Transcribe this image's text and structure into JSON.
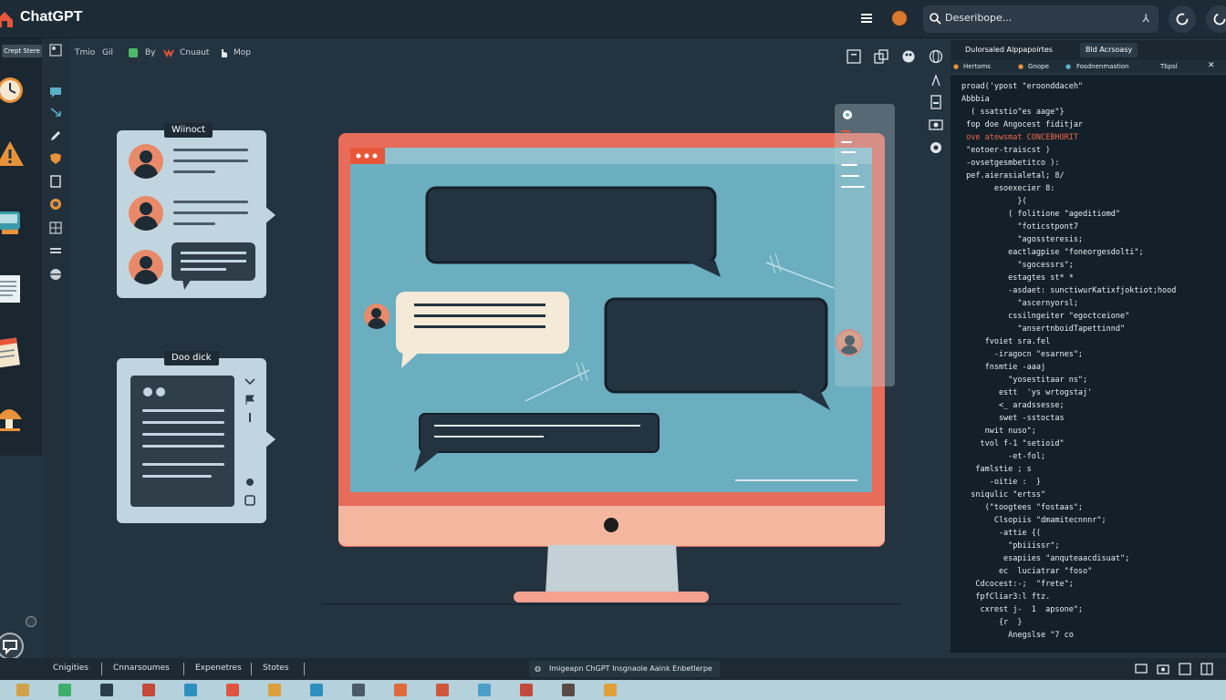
{
  "app": {
    "title": "ChatGPT",
    "search_text": "Deseribope...",
    "colors": {
      "background": "#243340",
      "topbar": "#1d2b36",
      "accent_coral": "#e86c5a",
      "screen_blue": "#6aaec0",
      "code_bg": "#142029"
    }
  },
  "toolbar": {
    "start_chip": "Crept Stere",
    "items": [
      {
        "label": "Tmio",
        "icon": "image-icon"
      },
      {
        "label": "Gil",
        "icon": ""
      },
      {
        "label": "By",
        "icon": "green-square-icon"
      },
      {
        "label": "Cnuaut",
        "icon": "palette-icon"
      },
      {
        "label": "Mop",
        "icon": "hand-icon"
      }
    ]
  },
  "left_dock": [
    "clock-icon",
    "warning-icon",
    "device-icon",
    "document-icon",
    "notepad-icon",
    "mushroom-icon",
    "chat-icon"
  ],
  "tool_column": [
    "chat-bubble-icon",
    "arrow-icon",
    "pen-icon",
    "shield-icon",
    "square-icon",
    "badge-icon",
    "grid-icon",
    "list-icon",
    "globe-icon"
  ],
  "canvas": {
    "card1_title": "Wiinoct",
    "card2_title": "Doo dick"
  },
  "right_tools": [
    "square-icon",
    "layers-icon",
    "palette-icon",
    "globe-icon",
    "cursor-icon",
    "document-icon",
    "camera-icon",
    "settings-icon"
  ],
  "code_panel": {
    "tab1": "Dulorsaled Alppapoirtes",
    "tab2": "Bld Acrsoasy",
    "subtabs": [
      "Hertoms",
      "Gnope",
      "Fosdnenmastion",
      "Tbpsl"
    ],
    "lines": [
      "proad('ypost \"eroonddaceh\"",
      "Abbbia",
      "  ( ssatstio\"es aage\"}",
      " fop doe Angocest fiditjar",
      " ove atewsmat CONCEBHORIT",
      " \"eotoer-traiscst )",
      " -ovsetgesmbetitco ):",
      " pef.aierasialetal; 8/",
      "       esoexecier 8:",
      "            }(",
      "          ( folitione \"ageditiomd\"",
      "            \"foticstpont7",
      "            \"agossteresis;",
      "          eactlagpise \"foneorgesdolti\";",
      "            \"sgocessrs\";",
      "          estagtes st* *",
      "          -asdaet: sunctiwurKatixfjoktiot;hood",
      "            \"ascernyorsl;",
      "          cssilngeiter \"egoctceione\"",
      "            \"ansertnboidTapettinnd\"",
      "     fvoiet sra.fel",
      "       -iragocn \"esarnes\";",
      "     fnsmtie -aaaj",
      "          \"yosestitaar ns\";",
      "        estt  'ys wrtogstaj'",
      "        <_ aradssesse;",
      "        swet -sstoctas",
      "     nwit nuso\";",
      "    tvol f-1 \"setioid\"",
      "          -et-fol;",
      "   famlstie ; s",
      "      -oitie :  }",
      "  sniqulic \"ertss\"",
      "     (\"toogtees \"fostaas\";",
      "       Clsopiis \"dmamitecnnnr\";",
      "        -attie {(",
      "          \"pbiiissr\";",
      "         esapiies \"anquteaacdisuat\";",
      "        ec  luciatrar \"foso\"",
      "   Cdcocest:-;  \"frete\";",
      "   fpfCliar3:l ftz.",
      "    cxrest j-  1  apsone\";",
      "        {r  }",
      "          Anegslse \"7 co"
    ]
  },
  "status_bar": {
    "items": [
      "Cnigities",
      "Cnnarsoumes",
      "Expenetres",
      "Stotes"
    ],
    "message": "Imigeapn ChGPT Insgnaole Aaink Enbetlerpe"
  },
  "taskbar": [
    "#d2a24a",
    "#3fae6a",
    "#2c3d4a",
    "#c44a3a",
    "#2f8fbf",
    "#e0553f",
    "#dba03a",
    "#2f8fbf",
    "#4a5a66",
    "#e06a3a",
    "#d0573a",
    "#4aa0c8",
    "#c24a3a",
    "#5a4a46",
    "#e0a03a"
  ]
}
